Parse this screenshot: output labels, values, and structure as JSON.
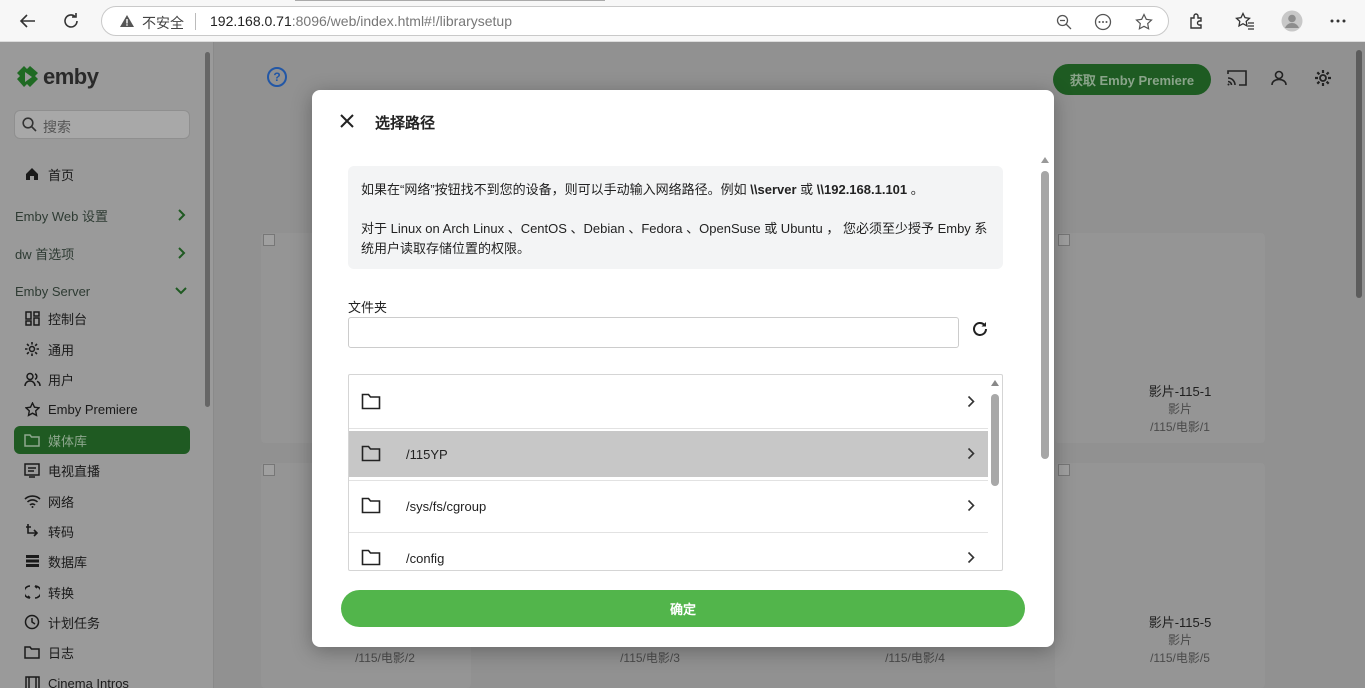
{
  "browser": {
    "security_label": "不安全",
    "url_host": "192.168.0.71",
    "url_rest": ":8096/web/index.html#!/librarysetup"
  },
  "sidebar": {
    "logo_text": "emby",
    "search_placeholder": "搜索",
    "home": "首页",
    "section_web": "Emby Web 设置",
    "section_dw": "dw 首选项",
    "section_server": "Emby Server",
    "items": [
      {
        "label": "控制台",
        "icon": "dashboard-icon"
      },
      {
        "label": "通用",
        "icon": "gear-icon"
      },
      {
        "label": "用户",
        "icon": "users-icon"
      },
      {
        "label": "Emby Premiere",
        "icon": "star-icon"
      },
      {
        "label": "媒体库",
        "icon": "folder-icon"
      },
      {
        "label": "电视直播",
        "icon": "tv-guide-icon"
      },
      {
        "label": "网络",
        "icon": "wifi-icon"
      },
      {
        "label": "转码",
        "icon": "transcode-icon"
      },
      {
        "label": "数据库",
        "icon": "database-icon"
      },
      {
        "label": "转换",
        "icon": "convert-icon"
      },
      {
        "label": "计划任务",
        "icon": "clock-icon"
      },
      {
        "label": "日志",
        "icon": "log-folder-icon"
      },
      {
        "label": "Cinema Intros",
        "icon": "film-icon"
      }
    ]
  },
  "header": {
    "premiere_button": "获取 Emby Premiere"
  },
  "cards": [
    {
      "title": "影片-115-1",
      "type": "影片",
      "path": "/115/电影/1"
    },
    {
      "title": "影片-115-5",
      "type": "影片",
      "path": "/115/电影/5"
    },
    {
      "path": "/115/电影/2"
    },
    {
      "path": "/115/电影/3"
    },
    {
      "path": "/115/电影/4"
    }
  ],
  "dialog": {
    "title": "选择路径",
    "info_line1_pre": "如果在“网络”按钮找不到您的设备，则可以手动输入网络路径。例如 ",
    "info_line1_server": "\\\\server",
    "info_line1_or": " 或 ",
    "info_line1_ip": "\\\\192.168.1.101",
    "info_line1_post": " 。",
    "info_line2": "对于 Linux on Arch Linux 、CentOS 、Debian 、Fedora 、OpenSuse 或 Ubuntu ， 您必须至少授予 Emby 系统用户读取存储位置的权限。",
    "folder_label": "文件夹",
    "folder_value": "",
    "folders": [
      "",
      "/115YP",
      "/sys/fs/cgroup",
      "/config"
    ],
    "confirm_button": "确定"
  }
}
